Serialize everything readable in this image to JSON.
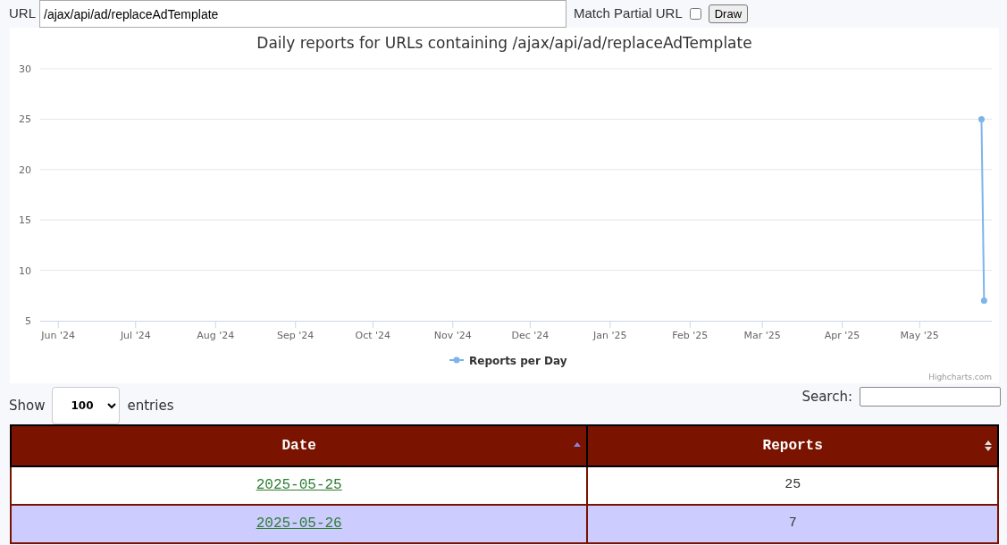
{
  "url_bar": {
    "label": "URL",
    "value": "/ajax/api/ad/replaceAdTemplate",
    "partial_label": "Match Partial URL",
    "partial_checked": false,
    "button": "Draw"
  },
  "chart": {
    "credit": "Highcharts.com",
    "chart_data": {
      "type": "line",
      "title": "Daily reports for URLs containing /ajax/api/ad/replaceAdTemplate",
      "x": [
        "2025-05-25",
        "2025-05-26"
      ],
      "series": [
        {
          "name": "Reports per Day",
          "color": "#7cb5ec",
          "marker": true,
          "values": [
            25,
            7
          ]
        }
      ],
      "xlim": [
        "2024-05-25",
        "2025-05-29"
      ],
      "grid": true,
      "ylim": [
        5,
        30
      ],
      "yticks": [
        5,
        10,
        15,
        20,
        25,
        30
      ],
      "xticks": [
        {
          "value": "2024-06-01",
          "label": "Jun '24"
        },
        {
          "value": "2024-07-01",
          "label": "Jul '24"
        },
        {
          "value": "2024-08-01",
          "label": "Aug '24"
        },
        {
          "value": "2024-09-01",
          "label": "Sep '24"
        },
        {
          "value": "2024-10-01",
          "label": "Oct '24"
        },
        {
          "value": "2024-11-01",
          "label": "Nov '24"
        },
        {
          "value": "2024-12-01",
          "label": "Dec '24"
        },
        {
          "value": "2025-01-01",
          "label": "Jan '25"
        },
        {
          "value": "2025-02-01",
          "label": "Feb '25"
        },
        {
          "value": "2025-03-01",
          "label": "Mar '25"
        },
        {
          "value": "2025-04-01",
          "label": "Apr '25"
        },
        {
          "value": "2025-05-01",
          "label": "May '25"
        }
      ]
    }
  },
  "table_controls": {
    "show_label": "Show",
    "page_size": "100",
    "entries_label": "entries",
    "search_label": "Search:"
  },
  "table": {
    "columns": [
      {
        "label": "Date",
        "sorted": true
      },
      {
        "label": "Reports",
        "sorted": false
      }
    ],
    "rows": [
      {
        "date": "2025-05-25",
        "reports": "25"
      },
      {
        "date": "2025-05-26",
        "reports": "7"
      }
    ]
  }
}
